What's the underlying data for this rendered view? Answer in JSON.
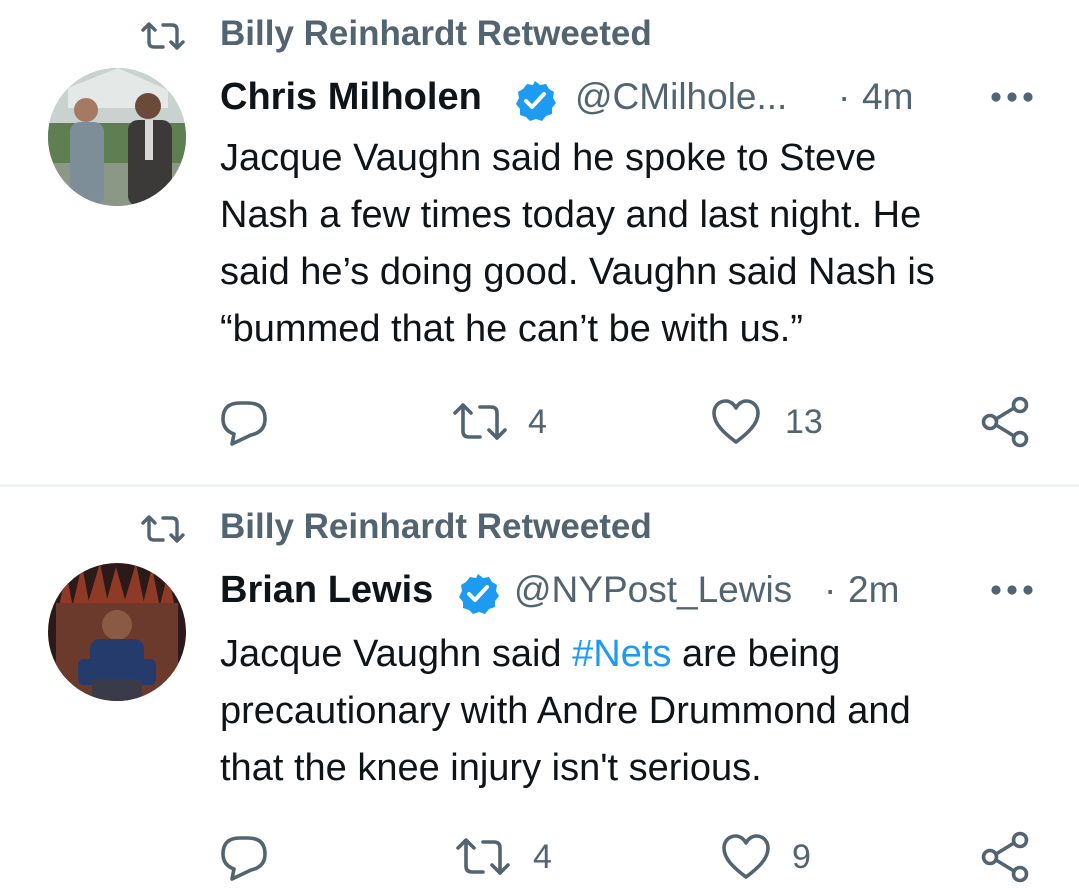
{
  "tweets": [
    {
      "retweeted_by": "Billy Reinhardt Retweeted",
      "author_name": "Chris Milholen",
      "handle": "@CMilhole...",
      "separator": "·",
      "time": "4m",
      "body_lines": [
        "Jacque Vaughn said he spoke to Steve",
        "Nash a few times today and last night. He",
        "said he’s doing good. Vaughn said Nash is",
        "“bummed that he can’t be with us.”"
      ],
      "retweet_count": "4",
      "like_count": "13"
    },
    {
      "retweeted_by": "Billy Reinhardt Retweeted",
      "author_name": "Brian Lewis",
      "handle": "@NYPost_Lewis",
      "separator": "·",
      "time": "2m",
      "body_line1_prefix": "Jacque Vaughn said ",
      "body_hashtag": "#Nets",
      "body_line1_suffix": " are being",
      "body_lines_rest": [
        "precautionary with Andre Drummond and",
        "that the knee injury isn't serious."
      ],
      "retweet_count": "4",
      "like_count": "9"
    }
  ],
  "icons": {
    "retweet": "retweet-icon",
    "verified": "verified-badge-icon",
    "more": "more-icon",
    "reply": "reply-icon",
    "like": "heart-icon",
    "share": "share-icon"
  },
  "colors": {
    "text": "#0f1419",
    "secondary": "#536471",
    "accent": "#1d9bf0",
    "divider": "#eff3f4"
  }
}
